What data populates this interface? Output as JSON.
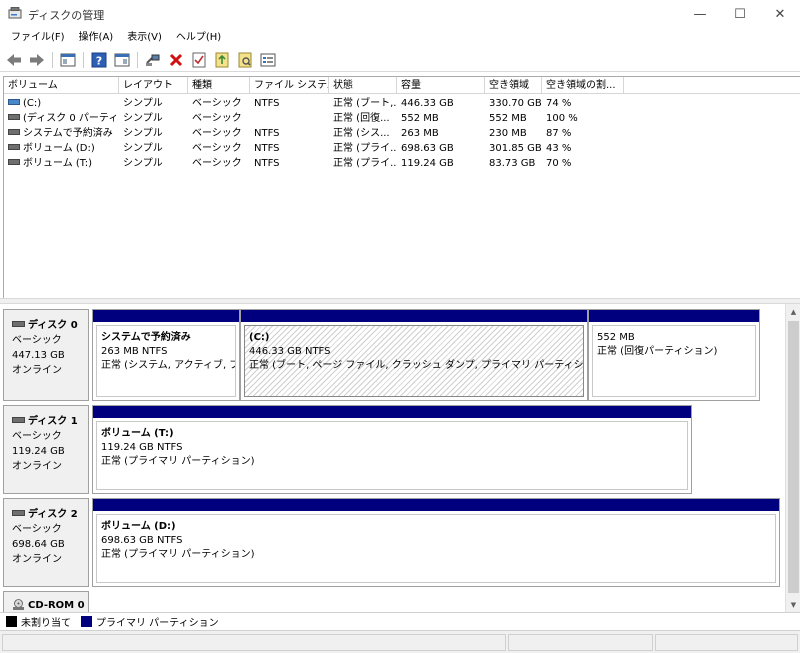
{
  "window": {
    "title": "ディスクの管理",
    "minimize": "—",
    "maximize": "☐",
    "close": "✕"
  },
  "menu": [
    "ファイル(F)",
    "操作(A)",
    "表示(V)",
    "ヘルプ(H)"
  ],
  "toolbar_icons": [
    "back-icon",
    "forward-icon",
    "console-tree-icon",
    "help-icon",
    "properties-icon",
    "connect-icon",
    "delete-icon",
    "check-icon",
    "export-icon",
    "refresh-icon",
    "list-icon"
  ],
  "colors": {
    "primary_partition": "#00007f",
    "unallocated": "#000000",
    "delete_red": "#d01010"
  },
  "volume_list": {
    "columns": [
      "ボリューム",
      "レイアウト",
      "種類",
      "ファイル システム",
      "状態",
      "容量",
      "空き領域",
      "空き領域の割..."
    ],
    "rows": [
      {
        "volume": "(C:)",
        "layout": "シンプル",
        "type": "ベーシック",
        "fs": "NTFS",
        "status": "正常 (ブート,...",
        "capacity": "446.33 GB",
        "free": "330.70 GB",
        "pct": "74 %",
        "icon": "blue"
      },
      {
        "volume": "(ディスク 0 パーティション...",
        "layout": "シンプル",
        "type": "ベーシック",
        "fs": "",
        "status": "正常 (回復...",
        "capacity": "552 MB",
        "free": "552 MB",
        "pct": "100 %",
        "icon": "gray"
      },
      {
        "volume": "システムで予約済み",
        "layout": "シンプル",
        "type": "ベーシック",
        "fs": "NTFS",
        "status": "正常 (シス...",
        "capacity": "263 MB",
        "free": "230 MB",
        "pct": "87 %",
        "icon": "gray"
      },
      {
        "volume": "ボリューム (D:)",
        "layout": "シンプル",
        "type": "ベーシック",
        "fs": "NTFS",
        "status": "正常 (プライ...",
        "capacity": "698.63 GB",
        "free": "301.85 GB",
        "pct": "43 %",
        "icon": "gray"
      },
      {
        "volume": "ボリューム (T:)",
        "layout": "シンプル",
        "type": "ベーシック",
        "fs": "NTFS",
        "status": "正常 (プライ...",
        "capacity": "119.24 GB",
        "free": "83.73 GB",
        "pct": "70 %",
        "icon": "gray"
      }
    ]
  },
  "disks": [
    {
      "name": "ディスク 0",
      "type": "ベーシック",
      "size": "447.13 GB",
      "status": "オンライン",
      "partitions": [
        {
          "name": "システムで予約済み",
          "size": "263 MB NTFS",
          "status": "正常 (システム, アクティブ, プライマ"
        },
        {
          "name": "(C:)",
          "size": "446.33 GB NTFS",
          "status": "正常 (ブート, ページ ファイル, クラッシュ ダンプ, プライマリ パーティション)"
        },
        {
          "name": "",
          "size": "552 MB",
          "status": "正常 (回復パーティション)"
        }
      ]
    },
    {
      "name": "ディスク 1",
      "type": "ベーシック",
      "size": "119.24 GB",
      "status": "オンライン",
      "partitions": [
        {
          "name": "ボリューム (T:)",
          "size": "119.24 GB NTFS",
          "status": "正常 (プライマリ パーティション)"
        }
      ]
    },
    {
      "name": "ディスク 2",
      "type": "ベーシック",
      "size": "698.64 GB",
      "status": "オンライン",
      "partitions": [
        {
          "name": "ボリューム (D:)",
          "size": "698.63 GB NTFS",
          "status": "正常 (プライマリ パーティション)"
        }
      ]
    },
    {
      "name": "CD-ROM 0"
    }
  ],
  "legend": [
    {
      "label": "未割り当て",
      "color": "#000000"
    },
    {
      "label": "プライマリ パーティション",
      "color": "#00007f"
    }
  ]
}
